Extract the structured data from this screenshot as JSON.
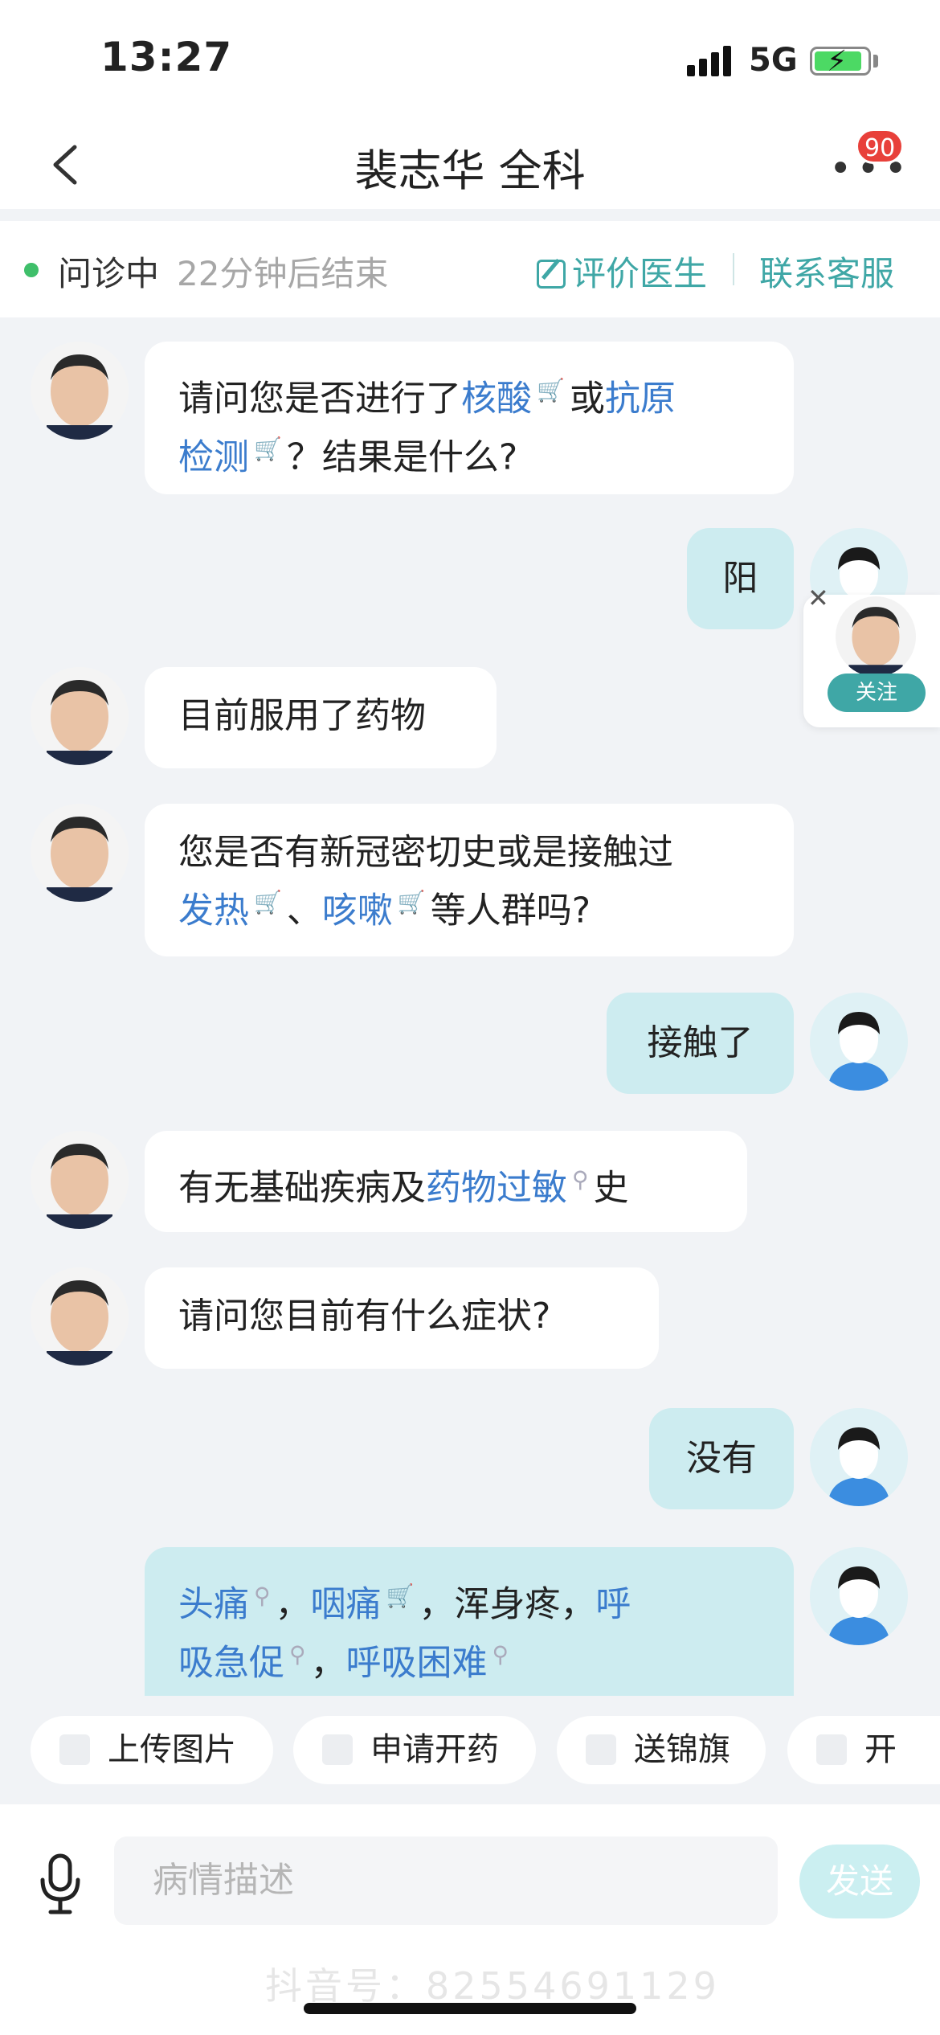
{
  "status_bar": {
    "time": "13:27",
    "network": "5G"
  },
  "nav": {
    "title": "裴志华 全科",
    "badge_count": "90"
  },
  "consult": {
    "status": "问诊中",
    "remaining": "22分钟后结束",
    "rate_label": "评价医生",
    "contact_label": "联系客服"
  },
  "messages": {
    "m1": {
      "a": "请问您是否进行了",
      "link1": "核酸",
      "b": "或",
      "link2": "抗原",
      "line2_link": "检测",
      "c": "？结果是什么?"
    },
    "m2": {
      "text": "阳"
    },
    "m3": {
      "text": "目前服用了药物"
    },
    "m4": {
      "line1": "您是否有新冠密切史或是接触过",
      "link1": "发热",
      "sep": "、",
      "link2": "咳嗽",
      "tail": "等人群吗?"
    },
    "m5": {
      "text": "接触了"
    },
    "m6": {
      "a": "有无基础疾病及",
      "link": "药物过敏",
      "b": "史"
    },
    "m7": {
      "text": "请问您目前有什么症状?"
    },
    "m8": {
      "text": "没有"
    },
    "m9": {
      "link1": "头痛",
      "sep1": "，",
      "link2": "咽痛",
      "mid": "，浑身疼，",
      "link3a": "呼",
      "link3b": "吸急促",
      "sep2": "，",
      "link4": "呼吸困难"
    }
  },
  "follow": {
    "label": "关注"
  },
  "quick_actions": [
    "上传图片",
    "申请开药",
    "送锦旗",
    "开"
  ],
  "input": {
    "placeholder": "病情描述",
    "send_label": "发送"
  },
  "watermark": "抖音号：82554691129"
}
